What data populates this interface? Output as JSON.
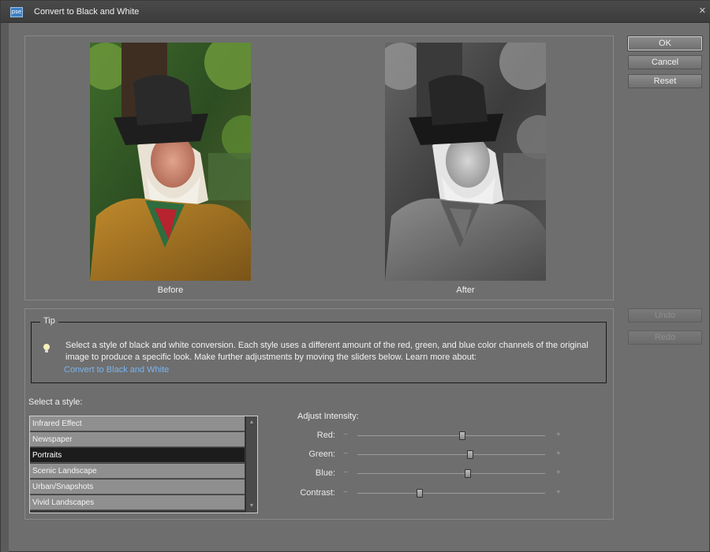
{
  "window": {
    "title": "Convert to Black and White",
    "app_icon_text": "pse"
  },
  "preview": {
    "before_caption": "Before",
    "after_caption": "After"
  },
  "buttons": {
    "ok": "OK",
    "cancel": "Cancel",
    "reset": "Reset",
    "undo": "Undo",
    "redo": "Redo"
  },
  "tip": {
    "legend": "Tip",
    "text": "Select a style of black and white conversion. Each style uses a different amount of the red, green, and blue color channels of the original image to produce a specific look. Make further adjustments by moving the sliders below. Learn more about:",
    "link": "Convert to Black and White"
  },
  "styles": {
    "label": "Select a style:",
    "items": [
      "Infrared Effect",
      "Newspaper",
      "Portraits",
      "Scenic Landscape",
      "Urban/Snapshots",
      "Vivid Landscapes"
    ],
    "selected": "Portraits"
  },
  "adjust": {
    "label": "Adjust Intensity:",
    "minus": "−",
    "plus": "+",
    "sliders": [
      {
        "label": "Red:",
        "value": 0.56
      },
      {
        "label": "Green:",
        "value": 0.6
      },
      {
        "label": "Blue:",
        "value": 0.59
      },
      {
        "label": "Contrast:",
        "value": 0.33
      }
    ]
  },
  "colors": {
    "dialog_bg": "#6e6e6e",
    "selected_row": "#1c1c1c",
    "link": "#7ab4f0"
  }
}
